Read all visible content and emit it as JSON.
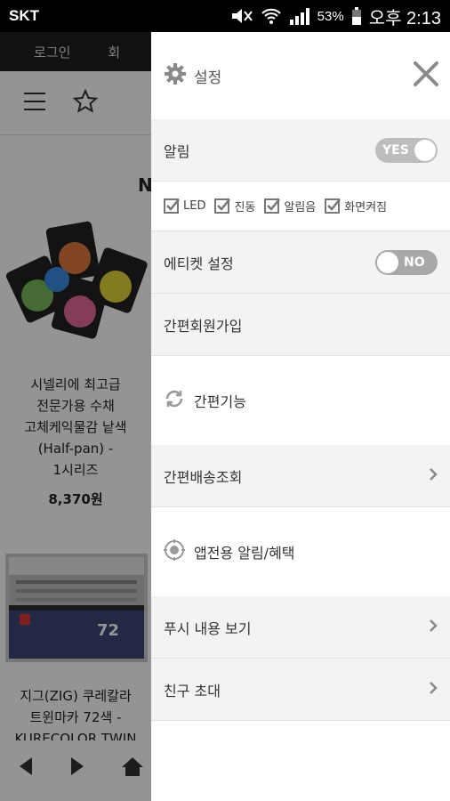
{
  "status_bar": {
    "carrier": "SKT",
    "battery": "53%",
    "time": "오후 2:13"
  },
  "background": {
    "tabs": [
      "로그인",
      "회"
    ],
    "letter": "N",
    "product1": {
      "name_lines": [
        "시넬리에 최고급",
        "전문가용 수채",
        "고체케익물감 낱색",
        "(Half-pan) -",
        "1시리즈"
      ],
      "price": "8,370원"
    },
    "product2": {
      "name_lines": [
        "지그(ZIG) 쿠레칼라",
        "트윈마카 72색 -",
        "KURECOLOR TWIN"
      ],
      "badge": "72"
    }
  },
  "drawer": {
    "title": "설정",
    "notification": {
      "label": "알림",
      "toggle": "YES"
    },
    "checks": [
      "LED",
      "진동",
      "알림음",
      "화면켜짐"
    ],
    "etiquette": {
      "label": "에티켓 설정",
      "toggle": "NO"
    },
    "signup": "간편회원가입",
    "easy_function": "간편기능",
    "delivery": "간편배송조회",
    "app_benefits": "앱전용 알림/혜택",
    "push_view": "푸시 내용 보기",
    "invite": "친구 초대"
  },
  "colors": {
    "status_bar": "#000000",
    "topbar": "#1e1e1e",
    "toggle": "#bdbdbd",
    "row_gray": "#f3f3f3",
    "overlay": "rgba(0,0,0,0.42)"
  }
}
